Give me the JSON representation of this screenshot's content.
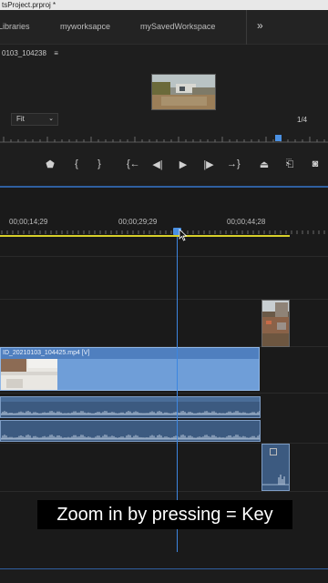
{
  "window": {
    "title": "tsProject.prproj *"
  },
  "workspaces": {
    "tabs": [
      "Libraries",
      "myworksapce",
      "mySavedWorkspace"
    ],
    "more_label": "»"
  },
  "program_monitor": {
    "sequence_name": "0103_104238",
    "menu_icon": "≡",
    "zoom_value": "Fit",
    "resolution": "1/4"
  },
  "transport": {
    "buttons": [
      {
        "name": "add-marker-icon",
        "glyph": "⬟"
      },
      {
        "name": "mark-in-icon",
        "glyph": "{"
      },
      {
        "name": "mark-out-icon",
        "glyph": "}"
      },
      {
        "name": "go-to-in-icon",
        "glyph": "{←"
      },
      {
        "name": "step-back-icon",
        "glyph": "◀|"
      },
      {
        "name": "play-icon",
        "glyph": "▶"
      },
      {
        "name": "step-forward-icon",
        "glyph": "|▶"
      },
      {
        "name": "go-to-out-icon",
        "glyph": "→}"
      },
      {
        "name": "lift-icon",
        "glyph": "⏏"
      },
      {
        "name": "extract-icon",
        "glyph": "⎗"
      },
      {
        "name": "export-frame-icon",
        "glyph": "◙"
      }
    ]
  },
  "timeline": {
    "timecodes": [
      "00;00;14;29",
      "00;00;29;29",
      "00;00;44;28"
    ],
    "video_clip_label": "ID_20210103_104425.mp4 [V]"
  },
  "caption": {
    "text": "Zoom in by pressing = Key"
  },
  "colors": {
    "accent": "#4a90e2",
    "work_area": "#d8d02a",
    "video_clip": "#6f9ed8",
    "audio_clip": "#3c5a80"
  }
}
